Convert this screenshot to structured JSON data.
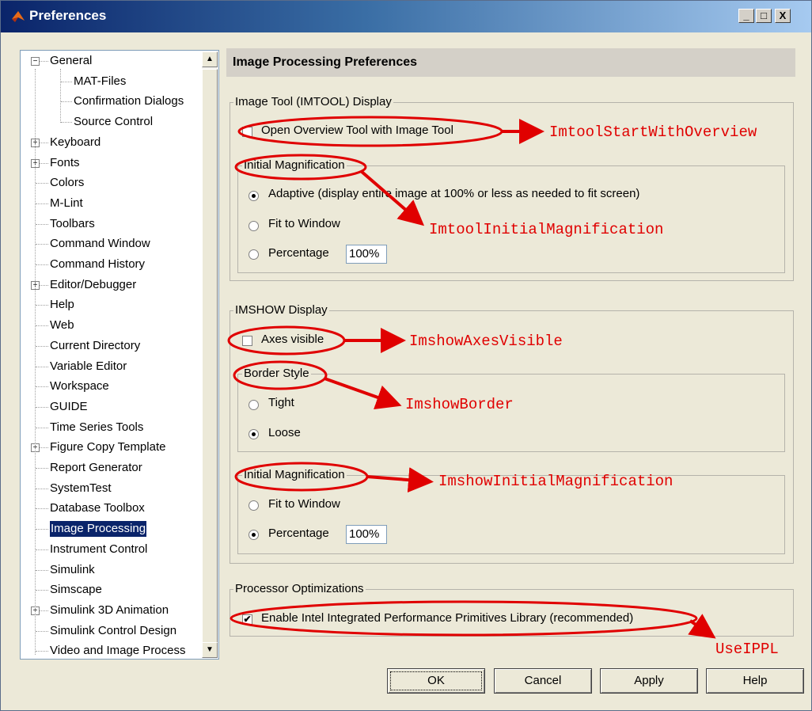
{
  "window": {
    "title": "Preferences",
    "controls": [
      "_",
      "□",
      "X"
    ]
  },
  "tree": {
    "items": [
      {
        "label": "General",
        "expander": "⊟"
      },
      {
        "label": "MAT-Files"
      },
      {
        "label": "Confirmation Dialogs"
      },
      {
        "label": "Source Control"
      },
      {
        "label": "Keyboard",
        "expander": "⊞"
      },
      {
        "label": "Fonts",
        "expander": "⊞"
      },
      {
        "label": "Colors"
      },
      {
        "label": "M-Lint"
      },
      {
        "label": "Toolbars"
      },
      {
        "label": "Command Window"
      },
      {
        "label": "Command History"
      },
      {
        "label": "Editor/Debugger",
        "expander": "⊞"
      },
      {
        "label": "Help"
      },
      {
        "label": "Web"
      },
      {
        "label": "Current Directory"
      },
      {
        "label": "Variable Editor"
      },
      {
        "label": "Workspace"
      },
      {
        "label": "GUIDE"
      },
      {
        "label": "Time Series Tools"
      },
      {
        "label": "Figure Copy Template",
        "expander": "⊞"
      },
      {
        "label": "Report Generator"
      },
      {
        "label": "SystemTest"
      },
      {
        "label": "Database Toolbox"
      },
      {
        "label": "Image Processing"
      },
      {
        "label": "Instrument Control"
      },
      {
        "label": "Simulink"
      },
      {
        "label": "Simscape"
      },
      {
        "label": "Simulink 3D Animation",
        "expander": "⊞"
      },
      {
        "label": "Simulink Control Design"
      },
      {
        "label": "Video and Image Process"
      }
    ],
    "selected": "Image Processing"
  },
  "panel": {
    "title": "Image Processing Preferences",
    "imtool": {
      "group_label": "Image Tool (IMTOOL) Display",
      "overview_label": "Open Overview Tool with Image Tool",
      "overview_checked": false,
      "magnification_label": "Initial Magnification",
      "adaptive_label": "Adaptive (display entire image at 100% or less as needed to fit screen)",
      "fit_label": "Fit to Window",
      "percentage_label": "Percentage",
      "percentage_value": "100%",
      "selected": "Adaptive"
    },
    "imshow": {
      "group_label": "IMSHOW Display",
      "axes_label": "Axes visible",
      "axes_checked": false,
      "border_label": "Border Style",
      "tight_label": "Tight",
      "loose_label": "Loose",
      "border_selected": "Loose",
      "magnification_label": "Initial Magnification",
      "fit_label": "Fit to Window",
      "percentage_label": "Percentage",
      "percentage_value": "100%",
      "selected": "Percentage"
    },
    "processor": {
      "group_label": "Processor Optimizations",
      "ippl_label": "Enable Intel Integrated Performance Primitives Library (recommended)",
      "ippl_checked": true
    }
  },
  "buttons": {
    "ok": "OK",
    "cancel": "Cancel",
    "apply": "Apply",
    "help": "Help"
  },
  "annotations": {
    "color": "#e00000",
    "start_overview": "ImtoolStartWithOverview",
    "imtool_mag": "ImtoolInitialMagnification",
    "axes_visible": "ImshowAxesVisible",
    "border": "ImshowBorder",
    "imshow_mag": "ImshowInitialMagnification",
    "ippl": "UseIPPL"
  }
}
